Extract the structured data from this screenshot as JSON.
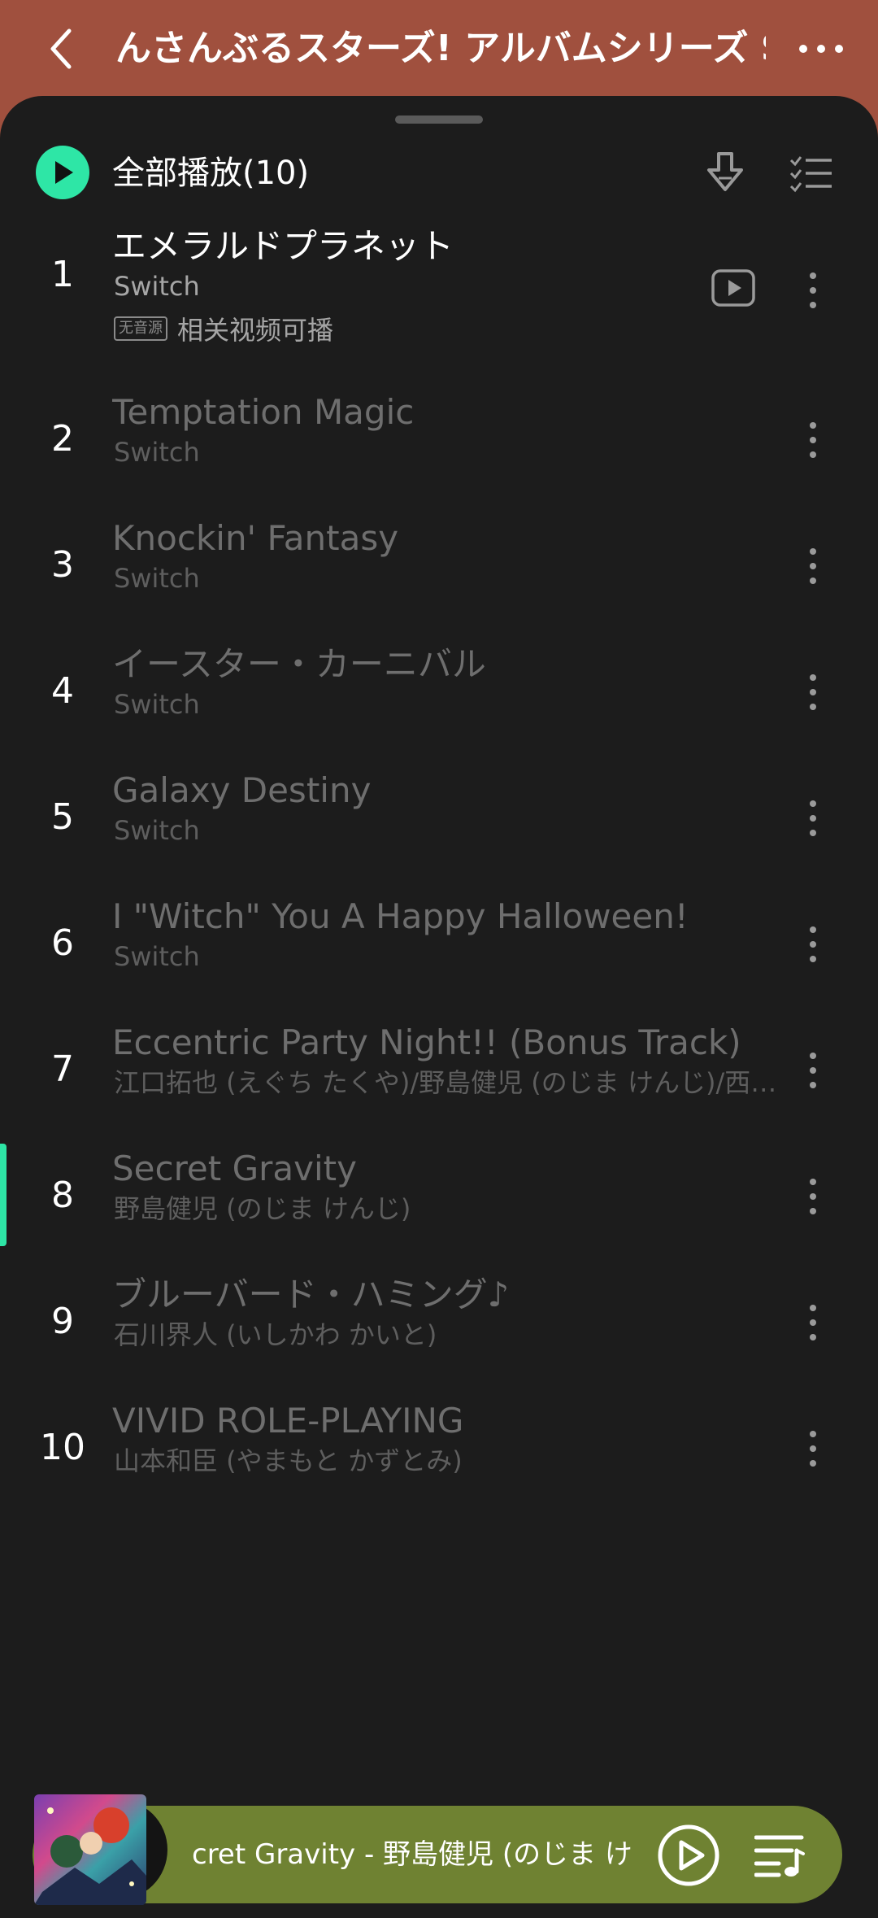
{
  "header": {
    "title": "んさんぶるスターズ! アルバムシリーズ Switch",
    "back_icon": "chevron-left-icon",
    "more_icon": "more-horizontal-icon",
    "background_color": "#a0503e"
  },
  "toolbar": {
    "play_all_label": "全部播放(10)",
    "accent_color": "#2ee6a6"
  },
  "songs": [
    {
      "num": "1",
      "title": "エメラルドプラネット",
      "artist": "Switch",
      "available": true,
      "no_source_tag": "无音源",
      "no_source_text": "相关视频可播"
    },
    {
      "num": "2",
      "title": "Temptation Magic",
      "artist": "Switch",
      "available": false
    },
    {
      "num": "3",
      "title": "Knockin' Fantasy",
      "artist": "Switch",
      "available": false
    },
    {
      "num": "4",
      "title": "イースター・カーニバル",
      "artist": "Switch",
      "available": false
    },
    {
      "num": "5",
      "title": "Galaxy Destiny",
      "artist": "Switch",
      "available": false
    },
    {
      "num": "6",
      "title": "I \"Witch\" You A Happy Halloween!",
      "artist": "Switch",
      "available": false
    },
    {
      "num": "7",
      "title": "Eccentric Party Night!! (Bonus Track)",
      "artist": "江口拓也 (えぐち たくや)/野島健児 (のじま けんじ)/西山宏太朗 (にしやま こうたろう)",
      "available": false
    },
    {
      "num": "8",
      "title": "Secret Gravity",
      "artist": "野島健児 (のじま けんじ)",
      "available": false,
      "now_playing": true
    },
    {
      "num": "9",
      "title": "ブルーバード・ハミング♪",
      "artist": "石川界人 (いしかわ かいと)",
      "available": false
    },
    {
      "num": "10",
      "title": "VIVID ROLE-PLAYING",
      "artist": "山本和臣 (やまもと かずとみ)",
      "available": false
    }
  ],
  "player": {
    "now_playing_text": "cret Gravity - 野島健児 (のじま けんじ)",
    "play_icon": "play-circle-icon",
    "queue_icon": "playlist-icon",
    "background_color": "#6f8232"
  }
}
